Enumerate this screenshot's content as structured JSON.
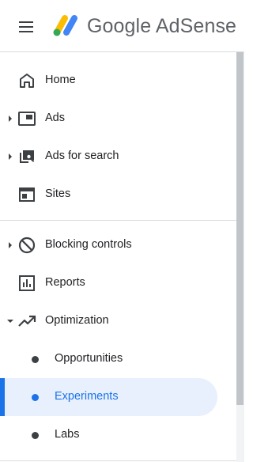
{
  "header": {
    "brand": "Google AdSense",
    "menu_icon": "hamburger-menu-icon",
    "logo_icon": "adsense-logo-icon",
    "logo_colors": [
      "#fbbc04",
      "#34a853",
      "#4285f4"
    ]
  },
  "nav": {
    "items": [
      {
        "label": "Home",
        "icon": "home-icon"
      },
      {
        "label": "Ads",
        "icon": "ads-icon",
        "expandable": true,
        "expanded": false
      },
      {
        "label": "Ads for search",
        "icon": "ads-for-search-icon",
        "expandable": true,
        "expanded": false
      },
      {
        "label": "Sites",
        "icon": "sites-icon"
      },
      {
        "label": "Blocking controls",
        "icon": "block-icon",
        "expandable": true,
        "expanded": false
      },
      {
        "label": "Reports",
        "icon": "reports-icon"
      },
      {
        "label": "Optimization",
        "icon": "optimization-icon",
        "expandable": true,
        "expanded": true,
        "children": [
          {
            "label": "Opportunities",
            "selected": false
          },
          {
            "label": "Experiments",
            "selected": true
          },
          {
            "label": "Labs",
            "selected": false
          }
        ]
      }
    ]
  },
  "colors": {
    "accent": "#1a73e8",
    "selected_background": "#e8f0fe",
    "text": "#202124",
    "divider": "#dadce0"
  }
}
